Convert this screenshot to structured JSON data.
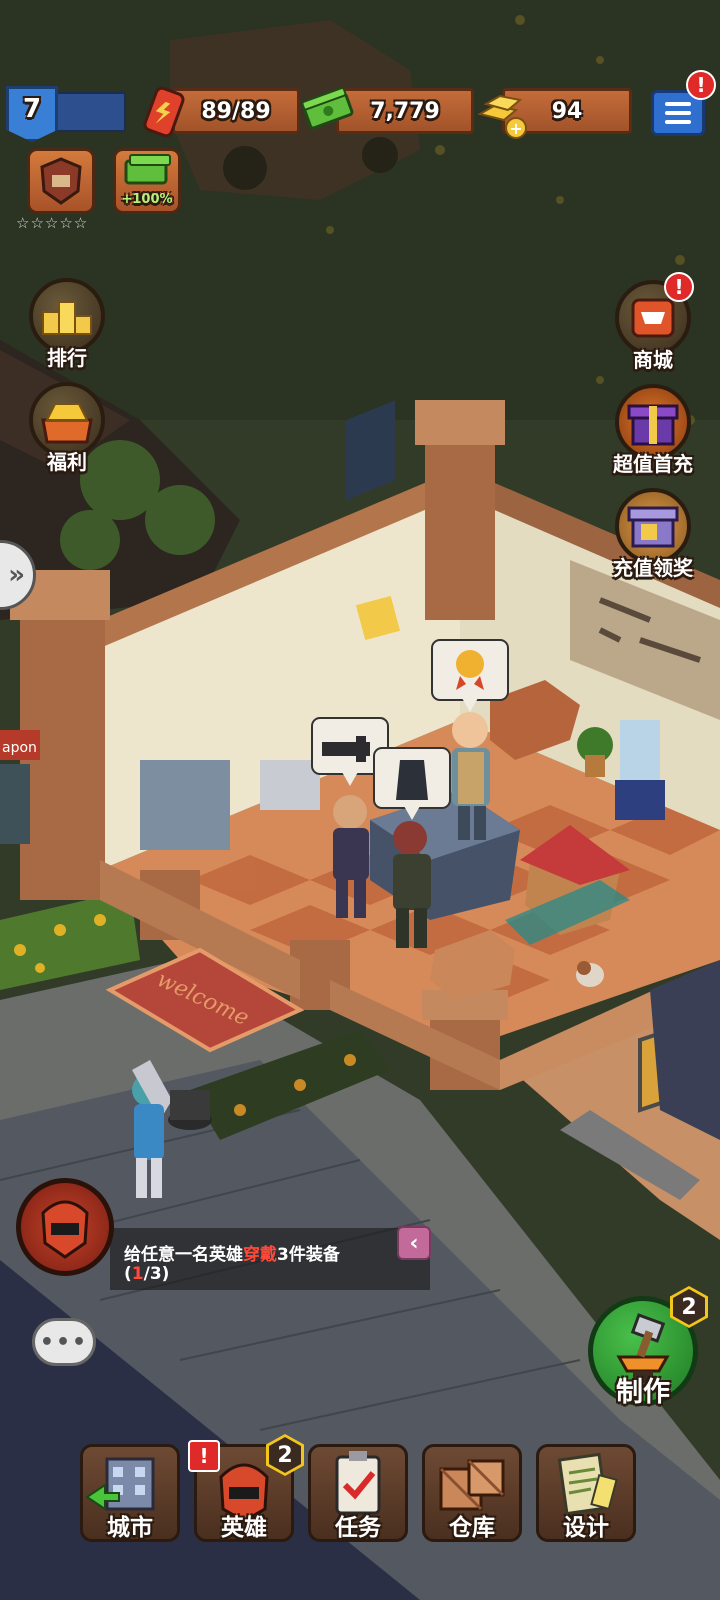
{
  "hud": {
    "level": "7",
    "energy": "89/89",
    "cash": "7,779",
    "gold": "94",
    "boost_label": "+100%",
    "stars": "☆☆☆☆☆",
    "menu_alert": "!"
  },
  "left_menu": [
    {
      "label": "排行",
      "icon": "leaderboard-icon"
    },
    {
      "label": "福利",
      "icon": "gold-chest-icon"
    }
  ],
  "right_menu": [
    {
      "label": "商城",
      "icon": "shop-cart-icon",
      "alert": "!"
    },
    {
      "label": "超值首充",
      "icon": "gift-box-icon"
    },
    {
      "label": "充值领奖",
      "icon": "reward-box-icon"
    }
  ],
  "quest": {
    "text_before": "给任意一名英雄",
    "text_highlight": "穿戴",
    "text_after": "3件装备",
    "progress_open": "(",
    "progress_current": "1",
    "progress_total": "/3)",
    "collapse_symbol": "‹"
  },
  "craft": {
    "label": "制作",
    "badge": "2"
  },
  "chat": {
    "symbol": "•••"
  },
  "bottom_nav": [
    {
      "label": "城市",
      "icon": "city-icon"
    },
    {
      "label": "英雄",
      "icon": "hero-helmet-icon",
      "badge": "2",
      "alert": "!"
    },
    {
      "label": "任务",
      "icon": "clipboard-task-icon"
    },
    {
      "label": "仓库",
      "icon": "warehouse-crate-icon"
    },
    {
      "label": "设计",
      "icon": "blueprint-icon"
    }
  ],
  "scene": {
    "doormat_text": "welcome",
    "side_sign_text": "apon"
  },
  "colors": {
    "grass": "#34402a",
    "floor_a": "#d68a5a",
    "floor_b": "#c2693f",
    "wall": "#ede6cc",
    "brand_orange": "#c46c3a",
    "accent_blue": "#2f6fd0",
    "craft_green": "#2f9a35"
  }
}
